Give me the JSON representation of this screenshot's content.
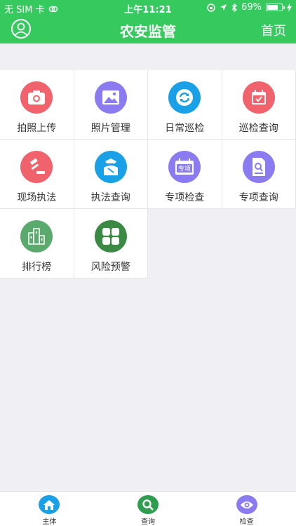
{
  "status_bar": {
    "carrier": "无 SIM 卡",
    "time": "上午11:21",
    "battery": "69%",
    "battery_level": 0.69
  },
  "nav": {
    "title": "农安监管",
    "right_label": "首页"
  },
  "menu": [
    {
      "label": "拍照上传",
      "icon": "camera-icon",
      "color": "#f0626c"
    },
    {
      "label": "照片管理",
      "icon": "image-icon",
      "color": "#8a7cf0"
    },
    {
      "label": "日常巡检",
      "icon": "refresh-icon",
      "color": "#1aa0e6"
    },
    {
      "label": "巡检查询",
      "icon": "calendar-check-icon",
      "color": "#f0626c"
    },
    {
      "label": "现场执法",
      "icon": "gavel-icon",
      "color": "#f0626c"
    },
    {
      "label": "执法查询",
      "icon": "officer-icon",
      "color": "#1aa0e6"
    },
    {
      "label": "专项检查",
      "icon": "calendar-badge-icon",
      "badge": "专项",
      "color": "#8a7cf0"
    },
    {
      "label": "专项查询",
      "icon": "document-search-icon",
      "color": "#8a7cf0"
    },
    {
      "label": "排行榜",
      "icon": "buildings-icon",
      "color": "#5aaa6e"
    },
    {
      "label": "风险预警",
      "icon": "grid-icon",
      "color": "#3b8a44"
    }
  ],
  "tabs": [
    {
      "label": "主体",
      "icon": "home-icon",
      "color": "#1aa0e6"
    },
    {
      "label": "查询",
      "icon": "search-icon",
      "color": "#2e9d4e"
    },
    {
      "label": "检查",
      "icon": "eye-icon",
      "color": "#8a7cf0"
    }
  ]
}
